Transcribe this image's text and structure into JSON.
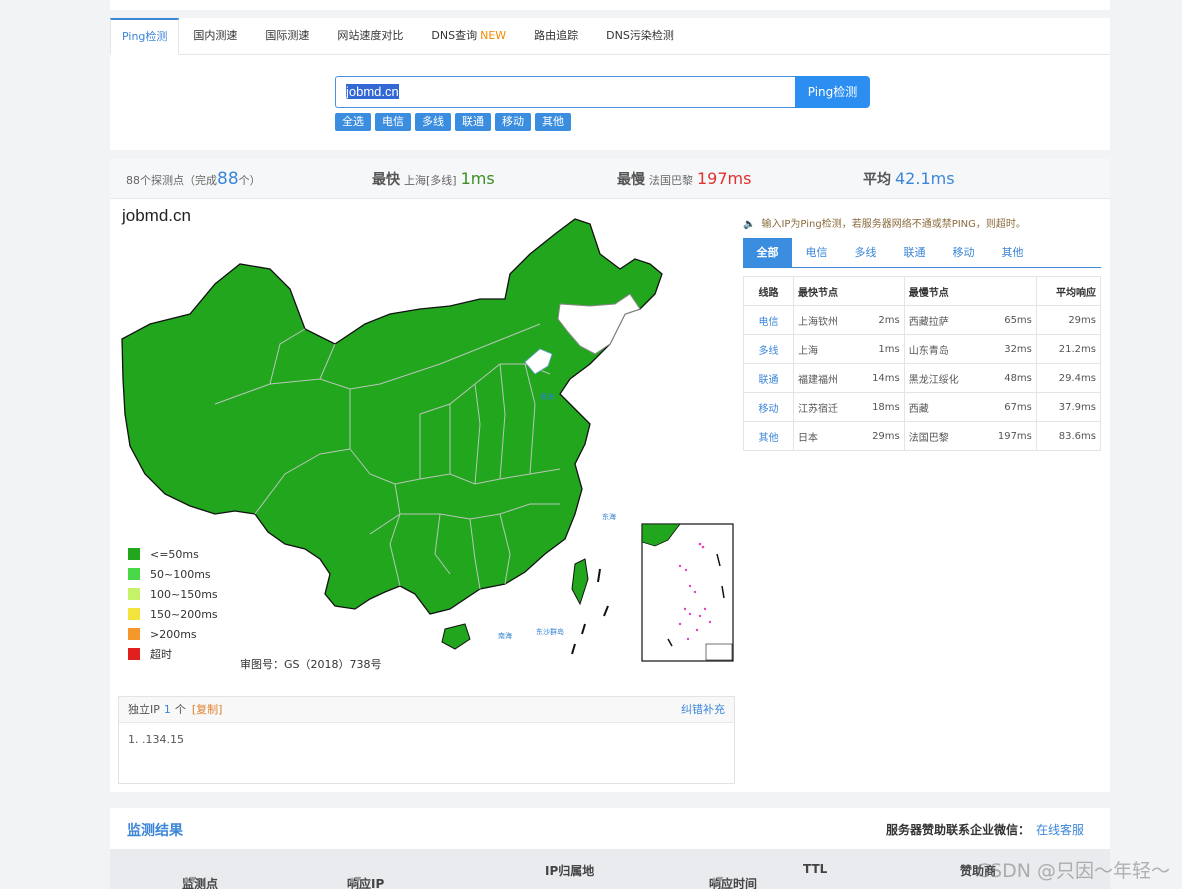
{
  "tabs": [
    {
      "label": "Ping检测"
    },
    {
      "label": "国内测速"
    },
    {
      "label": "国际测速"
    },
    {
      "label": "网站速度对比"
    },
    {
      "label": "DNS查询",
      "badge": "NEW"
    },
    {
      "label": "路由追踪"
    },
    {
      "label": "DNS污染检测"
    }
  ],
  "search": {
    "value": "jobmd.cn",
    "button": "Ping检测"
  },
  "isp_filters": [
    "全选",
    "电信",
    "多线",
    "联通",
    "移动",
    "其他"
  ],
  "summary": {
    "probes_prefix": "88个探测点（完成",
    "probes_done": "88",
    "probes_suffix": "个）",
    "fastest_label": "最快",
    "fastest_node": "上海[多线]",
    "fastest_value": "1ms",
    "slowest_label": "最慢",
    "slowest_node": "法国巴黎",
    "slowest_value": "197ms",
    "avg_label": "平均",
    "avg_value": "42.1ms"
  },
  "map": {
    "title": "jobmd.cn",
    "approval": "审图号：GS（2018）738号",
    "fill_color": "#22a61e",
    "legend": [
      {
        "label": "<=50ms",
        "color": "#22a61e"
      },
      {
        "label": "50~100ms",
        "color": "#48d848"
      },
      {
        "label": "100~150ms",
        "color": "#c6f26a"
      },
      {
        "label": "150~200ms",
        "color": "#f2e43a"
      },
      {
        "label": ">200ms",
        "color": "#f5982c"
      },
      {
        "label": "超时",
        "color": "#e0201c"
      }
    ]
  },
  "ip_box": {
    "label": "独立IP",
    "count": "1",
    "unit": "个",
    "copy": "[复制]",
    "fix": "纠错补充",
    "ip": "1.  .134.15",
    "ip_redacted": true
  },
  "tip": "输入IP为Ping检测，若服务器网络不通或禁PING，则超时。",
  "isp_tabs": [
    "全部",
    "电信",
    "多线",
    "联通",
    "移动",
    "其他"
  ],
  "table": {
    "headers": {
      "line": "线路",
      "fast": "最快节点",
      "slow": "最慢节点",
      "avg": "平均响应"
    },
    "rows": [
      {
        "line": "电信",
        "fast_node": "上海钦州",
        "fast_ms": "2ms",
        "slow_node": "西藏拉萨",
        "slow_ms": "65ms",
        "avg": "29ms"
      },
      {
        "line": "多线",
        "fast_node": "上海",
        "fast_ms": "1ms",
        "slow_node": "山东青岛",
        "slow_ms": "32ms",
        "avg": "21.2ms"
      },
      {
        "line": "联通",
        "fast_node": "福建福州",
        "fast_ms": "14ms",
        "slow_node": "黑龙江绥化",
        "slow_ms": "48ms",
        "avg": "29.4ms"
      },
      {
        "line": "移动",
        "fast_node": "江苏宿迁",
        "fast_ms": "18ms",
        "slow_node": "西藏",
        "slow_ms": "67ms",
        "avg": "37.9ms"
      },
      {
        "line": "其他",
        "fast_node": "日本",
        "fast_ms": "29ms",
        "slow_node": "法国巴黎",
        "slow_ms": "197ms",
        "avg": "83.6ms"
      }
    ]
  },
  "results": {
    "title": "监测结果",
    "sponsor": "服务器赞助联系企业微信：",
    "sponsor_link": "在线客服",
    "columns": [
      "监测点",
      "响应IP",
      "IP归属地",
      "响应时间",
      "TTL",
      "赞助商"
    ]
  },
  "watermark": "CSDN @只因～年轻～"
}
